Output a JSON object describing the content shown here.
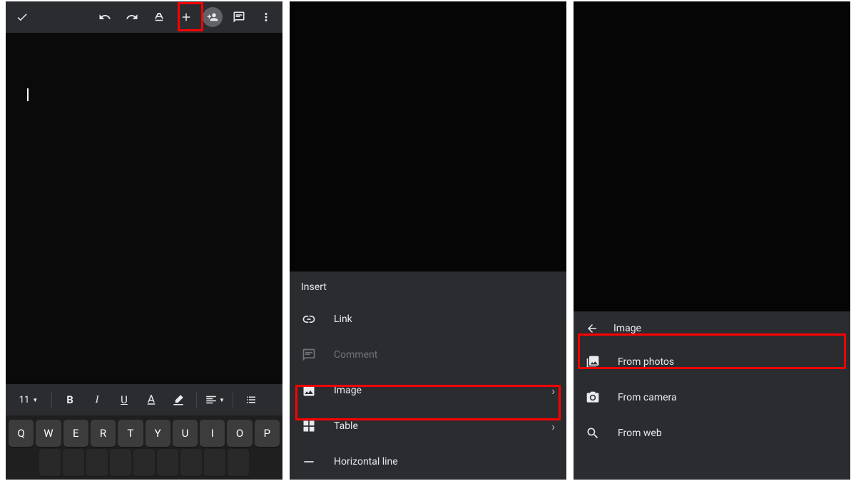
{
  "panel1": {
    "font_size": "11",
    "keys_row1": [
      "Q",
      "W",
      "E",
      "R",
      "T",
      "Y",
      "U",
      "I",
      "O",
      "P"
    ]
  },
  "panel2": {
    "sheet_title": "Insert",
    "items": [
      {
        "label": "Link",
        "icon": "link",
        "disabled": false,
        "chevron": false
      },
      {
        "label": "Comment",
        "icon": "comment",
        "disabled": true,
        "chevron": false
      },
      {
        "label": "Image",
        "icon": "image",
        "disabled": false,
        "chevron": true
      },
      {
        "label": "Table",
        "icon": "table",
        "disabled": false,
        "chevron": true
      },
      {
        "label": "Horizontal line",
        "icon": "hr",
        "disabled": false,
        "chevron": false
      }
    ]
  },
  "panel3": {
    "sheet_title": "Image",
    "items": [
      {
        "label": "From photos",
        "icon": "photos"
      },
      {
        "label": "From camera",
        "icon": "camera"
      },
      {
        "label": "From web",
        "icon": "search"
      }
    ]
  }
}
